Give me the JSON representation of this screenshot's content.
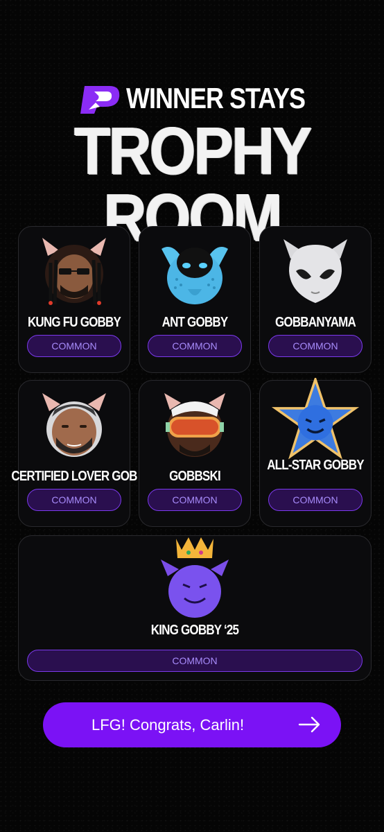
{
  "brand": {
    "name": "WINNER STAYS",
    "logo_icon": "winner-stays-logo-icon",
    "accent": "#7b12f5"
  },
  "page_title": "TROPHY ROOM",
  "trophies": [
    {
      "name": "KUNG FU GOBBY",
      "rarity": "COMMON",
      "icon": "kung-fu-gobby-avatar-icon"
    },
    {
      "name": "ANT GOBBY",
      "rarity": "COMMON",
      "icon": "ant-gobby-avatar-icon"
    },
    {
      "name": "GOBBANYAMA",
      "rarity": "COMMON",
      "icon": "gobbanyama-alien-avatar-icon"
    },
    {
      "name": "CERTIFIED LOVER GOB",
      "rarity": "COMMON",
      "icon": "certified-lover-gob-avatar-icon"
    },
    {
      "name": "GOBBSKI",
      "rarity": "COMMON",
      "icon": "gobbski-avatar-icon"
    },
    {
      "name": "ALL-STAR GOBBY",
      "rarity": "COMMON",
      "icon": "all-star-gobby-avatar-icon"
    },
    {
      "name": "KING GOBBY ‘25",
      "rarity": "COMMON",
      "icon": "king-gobby-avatar-icon"
    }
  ],
  "cta": {
    "label": "LFG! Congrats, Carlin!",
    "icon": "arrow-right-icon"
  },
  "colors": {
    "rarity_fill": "#2a0f4f",
    "rarity_border": "#7c3aed",
    "rarity_text": "#a78bfa",
    "card_bg": "#0b0b0d"
  }
}
